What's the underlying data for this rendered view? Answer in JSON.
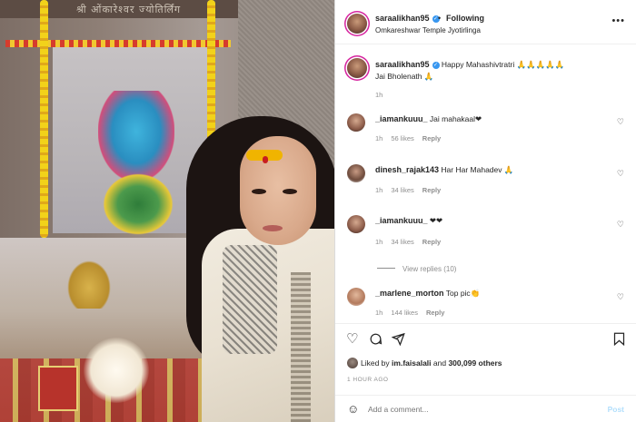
{
  "header": {
    "username": "saraalikhan95",
    "dot": "•",
    "following_label": "Following",
    "location": "Omkareshwar Temple Jyotirlinga",
    "more_icon": "more-horizontal-icon"
  },
  "photo": {
    "sign_text": "श्री ओंकारेश्वर ज्योतिर्लिंग"
  },
  "caption": {
    "username": "saraalikhan95",
    "line1": "Happy Mahashivtratri 🙏🙏🙏🙏🙏",
    "line2": "Jai Bholenath 🙏",
    "time": "1h"
  },
  "comments": [
    {
      "username": "_iamankuuu_",
      "text": "Jai mahakaal❤",
      "time": "1h",
      "likes": "56 likes",
      "reply": "Reply"
    },
    {
      "username": "dinesh_rajak143",
      "text": "Har Har Mahadev 🙏",
      "time": "1h",
      "likes": "34 likes",
      "reply": "Reply"
    },
    {
      "username": "_iamankuuu_",
      "text": "❤❤",
      "time": "1h",
      "likes": "34 likes",
      "reply": "Reply"
    },
    {
      "username": "_marlene_morton",
      "text": "Top pic👏",
      "time": "1h",
      "likes": "144 likes",
      "reply": "Reply"
    }
  ],
  "view_replies": "View replies (10)",
  "actions": {
    "liked_by_prefix": "Liked by",
    "liked_by_user": "im.faisalali",
    "liked_by_and": "and",
    "liked_by_count": "300,099 others",
    "time_ago": "1 HOUR AGO"
  },
  "add_comment": {
    "placeholder": "Add a comment...",
    "post_label": "Post"
  },
  "colors": {
    "verified": "#3897f0",
    "post_button_disabled": "#b2dffc",
    "muted_text": "#8e8e8e",
    "story_ring": "#d6249f"
  }
}
